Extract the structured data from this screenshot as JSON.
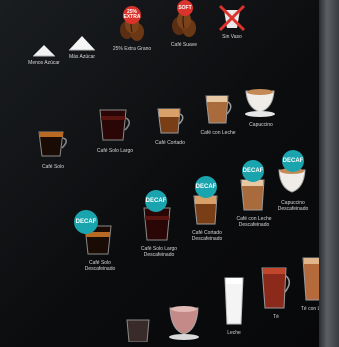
{
  "colors": {
    "decaf_badge": "#1aa4ad",
    "extra_badge": "#d9332b",
    "label_text": "#d8d8d8",
    "background": "#0d0f11"
  },
  "top_row": [
    {
      "label": "Menos Azúcar",
      "icon": "sugar-pile-small-icon"
    },
    {
      "label": "Más Azúcar",
      "icon": "sugar-pile-large-icon"
    },
    {
      "label": "25% Extra Grano",
      "icon": "coffee-beans-icon",
      "badge": "25%\nEXTRA"
    },
    {
      "label": "Café Suave",
      "icon": "coffee-beans-icon",
      "badge": "SOFT"
    },
    {
      "label": "Sin Vaso",
      "icon": "no-cup-icon"
    }
  ],
  "row2": [
    {
      "label": "Café Solo"
    },
    {
      "label": "Café Solo Largo"
    },
    {
      "label": "Café Cortado"
    },
    {
      "label": "Café con Leche"
    },
    {
      "label": "Capuccino"
    }
  ],
  "row3": [
    {
      "label": "Café Solo\nDescafeinado",
      "badge": "DECAF"
    },
    {
      "label": "Café Solo Largo\nDescafeinado",
      "badge": "DECAF"
    },
    {
      "label": "Café Cortado\nDescafeinado",
      "badge": "DECAF"
    },
    {
      "label": "Café con Leche\nDescafeinado",
      "badge": "DECAF"
    },
    {
      "label": "Capuccino\nDescafeinado",
      "badge": "DECAF"
    }
  ],
  "row4": [
    {
      "label": ""
    },
    {
      "label": ""
    },
    {
      "label": "Leche"
    },
    {
      "label": "Té"
    },
    {
      "label": "Té con Leche"
    }
  ]
}
